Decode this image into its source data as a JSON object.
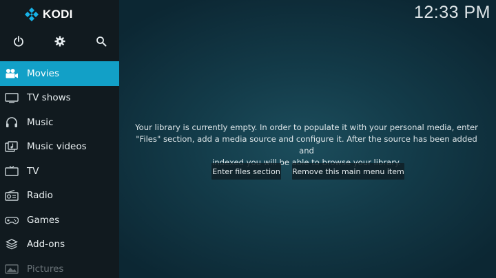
{
  "app": {
    "logo_text": "KODI",
    "clock": "12:33 PM"
  },
  "topbar": {
    "icons": [
      "power-icon",
      "gear-icon",
      "search-icon"
    ]
  },
  "menu": {
    "selected": "Movies",
    "items": [
      {
        "label": "Movies",
        "icon": "movies-icon"
      },
      {
        "label": "TV shows",
        "icon": "tv-shows-icon"
      },
      {
        "label": "Music",
        "icon": "headphones-icon"
      },
      {
        "label": "Music videos",
        "icon": "music-videos-icon"
      },
      {
        "label": "TV",
        "icon": "tv-icon"
      },
      {
        "label": "Radio",
        "icon": "radio-icon"
      },
      {
        "label": "Games",
        "icon": "gamepad-icon"
      },
      {
        "label": "Add-ons",
        "icon": "addons-icon"
      },
      {
        "label": "Pictures",
        "icon": "pictures-icon"
      }
    ]
  },
  "main": {
    "message_lines": [
      "Your library is currently empty. In order to populate it with your personal media, enter",
      "\"Files\" section, add a media source and configure it. After the source has been added and",
      "indexed you will be able to browse your library."
    ],
    "buttons": {
      "enter_files": "Enter files section",
      "remove_item": "Remove this main menu item"
    }
  },
  "colors": {
    "sidebar_bg": "#111a1f",
    "selected_bg": "#12a0c7",
    "main_bg": "#133b49",
    "logo_blue": "#17b2e7"
  }
}
